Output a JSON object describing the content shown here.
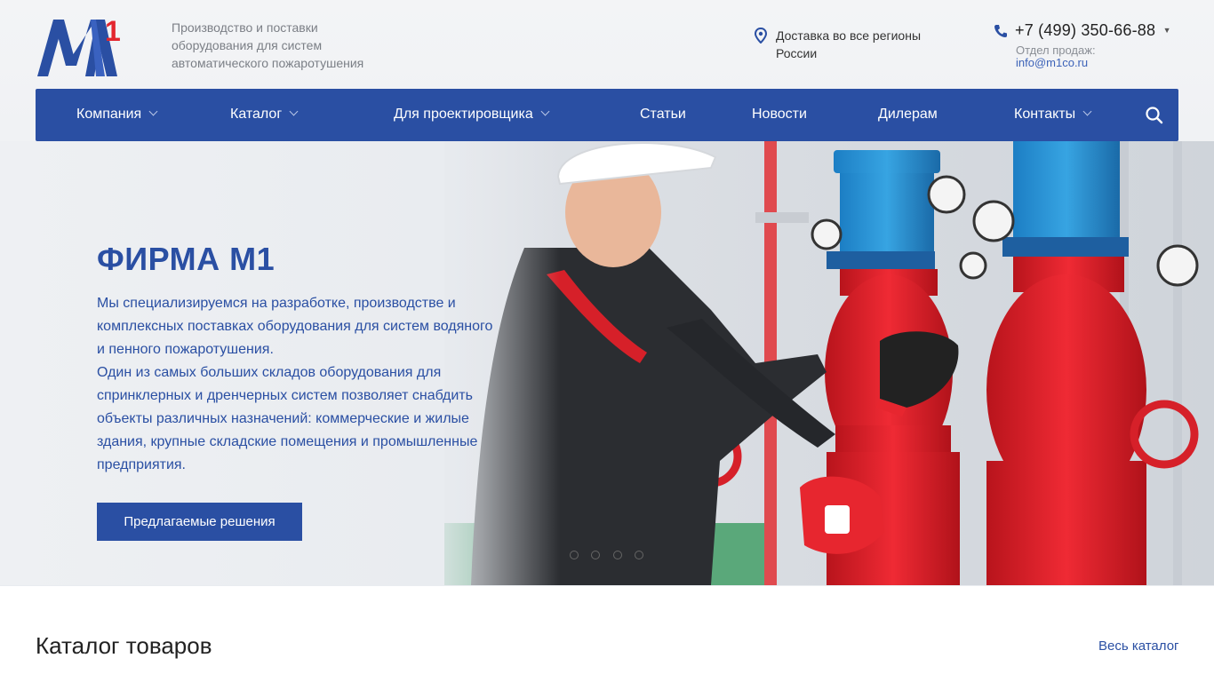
{
  "header": {
    "tagline": [
      "Производство и поставки",
      "оборудования для систем",
      "автоматического пожаротушения"
    ],
    "delivery": [
      "Доставка во все регионы",
      "России"
    ],
    "phone": "+7 (499) 350-66-88",
    "sales_label": "Отдел продаж:",
    "sales_email": "info@m1co.ru"
  },
  "nav": {
    "items": [
      {
        "label": "Компания",
        "has_dropdown": true
      },
      {
        "label": "Каталог",
        "has_dropdown": true
      },
      {
        "label": "Для проектировщика",
        "has_dropdown": true
      },
      {
        "label": "Статьи",
        "has_dropdown": false
      },
      {
        "label": "Новости",
        "has_dropdown": false
      },
      {
        "label": "Дилерам",
        "has_dropdown": false
      },
      {
        "label": "Контакты",
        "has_dropdown": true
      }
    ],
    "search_icon": "search-icon"
  },
  "hero": {
    "title": "ФИРМА М1",
    "text": [
      "Мы специализируемся на разработке, производстве и",
      "комплексных поставках оборудования для систем водяного",
      "и пенного пожаротушения.",
      "Один из самых больших складов оборудования для",
      "спринклерных и дренчерных систем позволяет снабдить",
      "объекты различных назначений: коммерческие и жилые",
      "здания, крупные складские помещения и промышленные",
      "предприятия."
    ],
    "button": "Предлагаемые решения"
  },
  "catalog": {
    "title": "Каталог товаров",
    "link": "Весь каталог"
  },
  "colors": {
    "brand_blue": "#2a4fa3",
    "accent_red": "#e3262f"
  }
}
